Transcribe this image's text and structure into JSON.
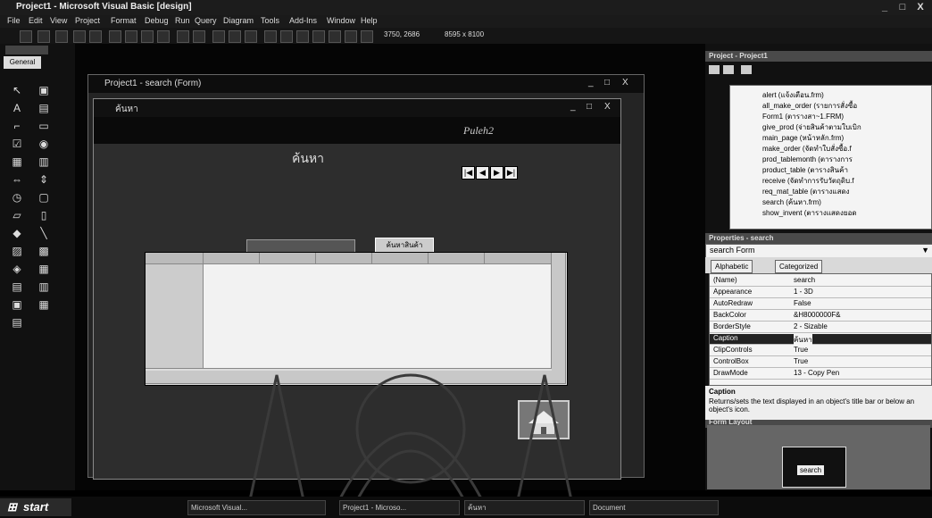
{
  "window": {
    "title": "Project1 - Microsoft Visual Basic [design]",
    "controls": [
      "_",
      "□",
      "X"
    ]
  },
  "menu": [
    "File",
    "Edit",
    "View",
    "Project",
    "Format",
    "Debug",
    "Run",
    "Query",
    "Diagram",
    "Tools",
    "Add-Ins",
    "Window",
    "Help"
  ],
  "toolbar": {
    "position": "3750, 2686",
    "size": "8595 x 8100"
  },
  "toolbox": {
    "tab": "General"
  },
  "project_window": {
    "title": "Project1 - search (Form)"
  },
  "form": {
    "title": "ค้นหา",
    "banner_text": "Puleh2",
    "heading": "ค้นหา",
    "search_button": "ค้นหาสินค้า",
    "nav_buttons": [
      "|◀",
      "◀",
      "▶",
      "▶|"
    ]
  },
  "project_explorer": {
    "title": "Project - Project1",
    "items": [
      "alert (แจ้งเตือน.frm)",
      "all_make_order (รายการสั่งซื้อ",
      "Form1 (ตารางสา~1.FRM)",
      "give_prod (จ่ายสินค้าตามใบเบิก",
      "main_page (หน้าหลัก.frm)",
      "make_order (จัดทำใบสั่งซื้อ.f",
      "prod_tablemonth (ตารางการ",
      "product_table (ตารางสินค้า",
      "receive (จัดทำการรับวัตถุดิบ.f",
      "req_mat_table (ตารางแสดง",
      "search (ค้นหา.frm)",
      "show_invent (ตารางแสดงยอด"
    ]
  },
  "properties": {
    "title": "Properties - search",
    "object": "search Form",
    "tabs": [
      "Alphabetic",
      "Categorized"
    ],
    "rows": [
      {
        "name": "(Name)",
        "value": "search"
      },
      {
        "name": "Appearance",
        "value": "1 - 3D"
      },
      {
        "name": "AutoRedraw",
        "value": "False"
      },
      {
        "name": "BackColor",
        "value": "&H8000000F&"
      },
      {
        "name": "BorderStyle",
        "value": "2 - Sizable"
      },
      {
        "name": "Caption",
        "value": "ค้นหา"
      },
      {
        "name": "ClipControls",
        "value": "True"
      },
      {
        "name": "ControlBox",
        "value": "True"
      },
      {
        "name": "DrawMode",
        "value": "13 - Copy Pen"
      }
    ],
    "help_title": "Caption",
    "help_text": "Returns/sets the text displayed in an object's title bar or below an object's icon."
  },
  "form_layout": {
    "title": "Form Layout",
    "mini_label": "search"
  },
  "taskbar": {
    "start": "start",
    "tasks": [
      "Microsoft Visual...",
      "Project1 - Microso...",
      "ค้นหา",
      "Document"
    ]
  },
  "colors": {
    "background": "#000000",
    "panel": "#f4f4f4",
    "titlebar": "#1c1c1c"
  }
}
